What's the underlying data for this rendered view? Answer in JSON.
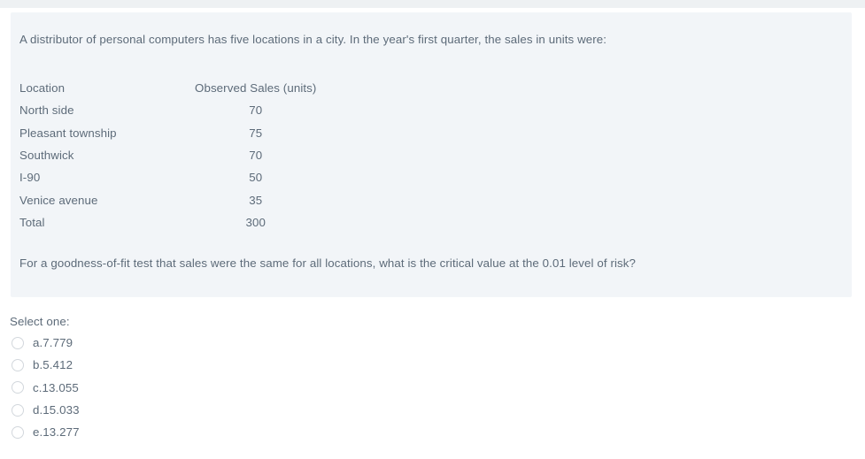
{
  "top_strip": {
    "color": "#eef1f3"
  },
  "question": {
    "panel_color": "#f2f5f8",
    "text_color": "#5d6b79",
    "stem": "A distributor of personal computers has five locations in a city. In the year's first quarter, the sales in units were:",
    "closing": "For a goodness-of-fit test that sales were the same for all locations, what is the critical value at the 0.01 level of risk?",
    "table": {
      "headers": [
        "Location",
        "Observed Sales (units)"
      ],
      "rows": [
        {
          "location": "North side",
          "observed": "70"
        },
        {
          "location": "Pleasant township",
          "observed": "75"
        },
        {
          "location": "Southwick",
          "observed": "70"
        },
        {
          "location": "I-90",
          "observed": "50"
        },
        {
          "location": "Venice avenue",
          "observed": "35"
        },
        {
          "location": "Total",
          "observed": "300"
        }
      ]
    }
  },
  "answer": {
    "select_label": "Select one:",
    "options": [
      {
        "label": "a.7.779"
      },
      {
        "label": "b.5.412"
      },
      {
        "label": "c.13.055"
      },
      {
        "label": "d.15.033"
      },
      {
        "label": "e.13.277"
      }
    ]
  }
}
